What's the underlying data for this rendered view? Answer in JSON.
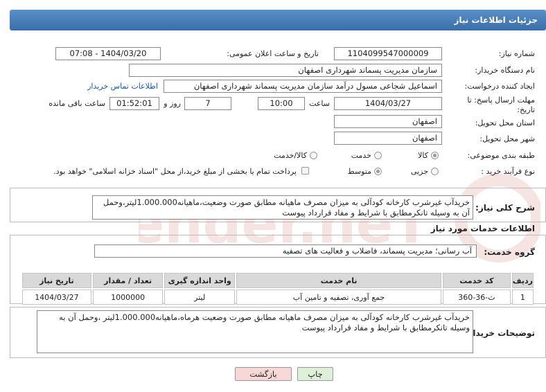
{
  "header": {
    "title": "جزئیات اطلاعات نیاز"
  },
  "fields": {
    "need_number_label": "شماره نیاز:",
    "need_number": "1104099547000009",
    "announce_label": "تاریخ و ساعت اعلان عمومی:",
    "announce_value": "1404/03/20 - 07:08",
    "buyer_org_label": "نام دستگاه خریدار:",
    "buyer_org": "سازمان مدیریت پسماند شهرداری اصفهان",
    "creator_label": "ایجاد کننده درخواست:",
    "creator": "اسماعیل شجاعی مسول درآمد سازمان مدیریت پسماند شهرداری اصفهان",
    "contact_link": "اطلاعات تماس خریدار",
    "deadline_label_1": "مهلت ارسال پاسخ: تا",
    "deadline_label_2": "تاریخ:",
    "deadline_date": "1404/03/27",
    "time_label": "ساعت",
    "deadline_time": "10:00",
    "days_value": "7",
    "days_label": "روز و",
    "remaining_time": "01:52:01",
    "remaining_label": "ساعت باقی مانده",
    "province_label": "استان محل تحویل:",
    "province": "اصفهان",
    "city_label": "شهر محل تحویل:",
    "city": "اصفهان",
    "category_label": "طبقه بندی موضوعی:",
    "category_options": [
      "کالا",
      "خدمت",
      "کالا/خدمت"
    ],
    "process_label": "نوع فرآیند خرید :",
    "process_options": [
      "جزیی",
      "متوسط"
    ],
    "payment_note": "پرداخت تمام یا بخشی از مبلغ خرید،از محل \"اسناد خزانه اسلامی\" خواهد بود."
  },
  "summary": {
    "label": "شرح کلی نیاز:",
    "text": "خریدآب غیرشرب کارخانه کودآلی  به میزان مصرف ماهیانه مطابق صورت وضعیت،ماهیانه1.000.000لیتر،وحمل آن به وسیله تانکرمطابق با شرایط و مفاد قرارداد پیوست"
  },
  "services": {
    "section_title": "اطلاعات خدمات مورد نیاز",
    "group_label": "گروه خدمت:",
    "group_value": "آب رسانی؛ مدیریت پسماند، فاضلاب و فعالیت های تصفیه",
    "columns": [
      "ردیف",
      "کد خدمت",
      "نام خدمت",
      "واحد اندازه گیری",
      "تعداد / مقدار",
      "تاریخ نیاز"
    ],
    "rows": [
      [
        "1",
        "ث-36-360",
        "جمع آوری، تصفیه و تامین آب",
        "لیتر",
        "1000000",
        "1404/03/27"
      ]
    ]
  },
  "buyer_notes": {
    "label": "توضیحات خریدار:",
    "text": "خریدآب غیرشرب کارخانه کودآلی  به میزان مصرف ماهیانه مطابق صورت وضعیت هرماه،ماهیانه1.000.000لیتر ،وحمل آن به وسیله تانکرمطابق با شرایط و مفاد قرارداد پیوست"
  },
  "buttons": {
    "print": "چاپ",
    "back": "بازگشت"
  },
  "watermark": "AriaTender.neT",
  "colors": {
    "header": "#4a7fbb",
    "back_button": "#f8d7d7",
    "print_button": "#dff0d8"
  }
}
